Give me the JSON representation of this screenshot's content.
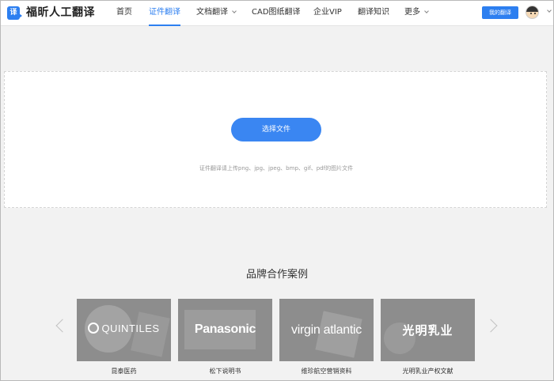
{
  "header": {
    "logo_glyph": "译",
    "logo_text": "福昕人工翻译",
    "nav": [
      {
        "label": "首页"
      },
      {
        "label": "证件翻译"
      },
      {
        "label": "文档翻译"
      },
      {
        "label": "CAD图纸翻译"
      },
      {
        "label": "企业VIP"
      },
      {
        "label": "翻译知识"
      },
      {
        "label": "更多"
      }
    ],
    "active_nav": "证件翻译",
    "my_translation_label": "我的翻译"
  },
  "upload": {
    "button_label": "选择文件",
    "hint": "证件翻译请上传png、jpg、jpeg、bmp、gif、pdf的图片文件"
  },
  "brands": {
    "title": "品牌合作案例",
    "cards": [
      {
        "logo_text": "QUINTILES",
        "name": "昆泰医药"
      },
      {
        "logo_text": "Panasonic",
        "name": "松下说明书"
      },
      {
        "logo_text": "virgin atlantic",
        "name": "维珍航空营销资料"
      },
      {
        "logo_text": "光明乳业",
        "name": "光明乳业产权文献"
      }
    ]
  },
  "colors": {
    "accent": "#2d7ff0",
    "page_bg": "#f2f2f2",
    "card_overlay": "#8d8d8d"
  },
  "icons": [
    "logo-icon",
    "chevron-down-icon",
    "avatar-icon",
    "chevron-left-icon",
    "chevron-right-icon",
    "quintiles-logo",
    "panasonic-logo",
    "virgin-atlantic-logo",
    "guangming-logo"
  ]
}
